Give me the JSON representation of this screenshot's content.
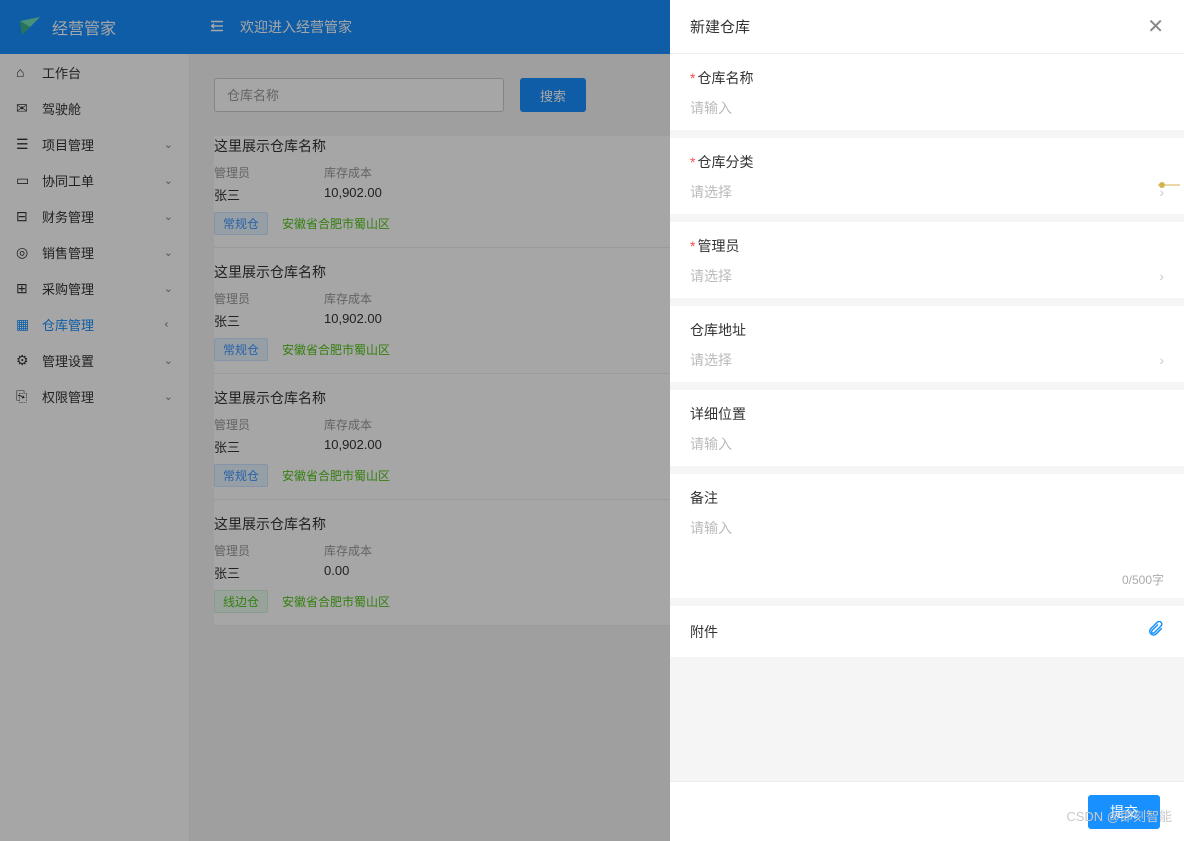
{
  "header": {
    "app_name": "经营管家",
    "welcome": "欢迎进入经营管家"
  },
  "sidebar": {
    "items": [
      {
        "icon": "⌂",
        "label": "工作台",
        "hasChildren": false
      },
      {
        "icon": "✉",
        "label": "驾驶舱",
        "hasChildren": false
      },
      {
        "icon": "☰",
        "label": "项目管理",
        "hasChildren": true
      },
      {
        "icon": "▭",
        "label": "协同工单",
        "hasChildren": true
      },
      {
        "icon": "⊟",
        "label": "财务管理",
        "hasChildren": true
      },
      {
        "icon": "◎",
        "label": "销售管理",
        "hasChildren": true
      },
      {
        "icon": "⊞",
        "label": "采购管理",
        "hasChildren": true
      },
      {
        "icon": "▦",
        "label": "仓库管理",
        "hasChildren": true,
        "active": true,
        "expanded": true
      },
      {
        "icon": "⚙",
        "label": "管理设置",
        "hasChildren": true
      },
      {
        "icon": "⎘",
        "label": "权限管理",
        "hasChildren": true
      }
    ]
  },
  "search": {
    "placeholder": "仓库名称",
    "button": "搜索"
  },
  "cards_meta": {
    "manager_label": "管理员",
    "cost_label": "库存成本"
  },
  "cards": [
    {
      "title": "这里展示仓库名称",
      "manager": "张三",
      "cost": "10,902.00",
      "tag_type": "常规仓",
      "tag_class": "blue",
      "location": "安徽省合肥市蜀山区"
    },
    {
      "title": "这里展示仓库名称",
      "manager": "张三",
      "cost": "10,902.00",
      "tag_type": "常规仓",
      "tag_class": "blue",
      "location": "安徽省合肥市蜀山区"
    },
    {
      "title": "这里展示仓库名称",
      "manager": "张三",
      "cost": "10,902.00",
      "tag_type": "常规仓",
      "tag_class": "blue",
      "location": "安徽省合肥市蜀山区"
    },
    {
      "title": "这里展示仓库名称",
      "manager": "张三",
      "cost": "0.00",
      "tag_type": "线边仓",
      "tag_class": "green",
      "location": "安徽省合肥市蜀山区"
    }
  ],
  "drawer": {
    "title": "新建仓库",
    "fields": {
      "name": {
        "label": "仓库名称",
        "required": true,
        "placeholder": "请输入",
        "type": "input"
      },
      "category": {
        "label": "仓库分类",
        "required": true,
        "placeholder": "请选择",
        "type": "select"
      },
      "manager": {
        "label": "管理员",
        "required": true,
        "placeholder": "请选择",
        "type": "select"
      },
      "address": {
        "label": "仓库地址",
        "required": false,
        "placeholder": "请选择",
        "type": "select"
      },
      "detail": {
        "label": "详细位置",
        "required": false,
        "placeholder": "请输入",
        "type": "input"
      },
      "remark": {
        "label": "备注",
        "required": false,
        "placeholder": "请输入",
        "type": "textarea",
        "count": "0/500字"
      },
      "attachment": {
        "label": "附件"
      }
    },
    "submit": "提交"
  },
  "watermark": "CSDN @即刻智能"
}
